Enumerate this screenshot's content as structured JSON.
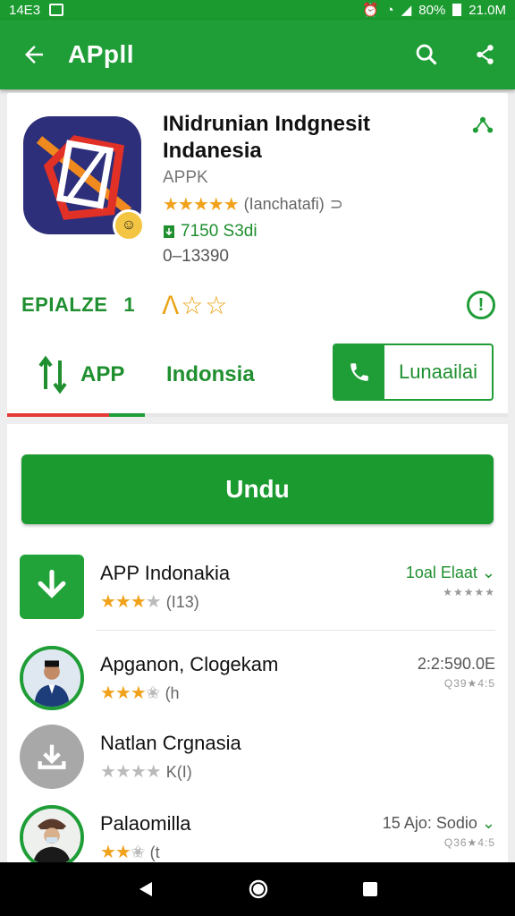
{
  "status": {
    "left_text": "14E3",
    "battery": "80%",
    "time": "21.0M"
  },
  "appbar": {
    "title": "APpll",
    "back_icon": "arrow-left-icon",
    "search_icon": "search-icon",
    "share_icon": "share-icon"
  },
  "app": {
    "title": "INidrunian Indgnesit Indanesia",
    "developer": "APPK",
    "stars": "★★★★★",
    "rating_text": "(Ianchatafi)",
    "rating_suffix": "⊃",
    "downloads": "7150 S3di",
    "size": "0–13390",
    "badge_icon": "face-icon"
  },
  "mid": {
    "left_label": "EPIALZE",
    "num": "1",
    "stars": "ⴷ☆☆"
  },
  "tabs": {
    "app_label": "APP",
    "indo_label": "Indonsia",
    "button_label": "Lunaailai"
  },
  "install_button": "Undu",
  "list": [
    {
      "name": "APP Indonakia",
      "stars": "★★★",
      "grey": "★",
      "count": "(I13)",
      "right_top": "1oal Elaat",
      "right_bottom": "★★★★★",
      "chevron": "⌄"
    },
    {
      "name": "Apganon, Clogekam",
      "stars": "★★★",
      "grey": "✬",
      "count": "(h",
      "right_top": "2:2:590.0E",
      "right_bottom": "Q39★4:5",
      "chevron": ""
    },
    {
      "name": "Natlan Crgnasia",
      "stars": "",
      "grey": "★★★★",
      "count": "K(I)",
      "right_top": "",
      "right_bottom": "",
      "chevron": ""
    },
    {
      "name": "Palaomilla",
      "stars": "★★",
      "grey": "✬",
      "count": "(t",
      "right_top": "15 Ajo: Sodio",
      "right_bottom": "Q36★4:5",
      "chevron": "⌄"
    }
  ],
  "colors": {
    "primary": "#1f9d36",
    "star": "#f1a21c",
    "accent_red": "#e53935"
  }
}
